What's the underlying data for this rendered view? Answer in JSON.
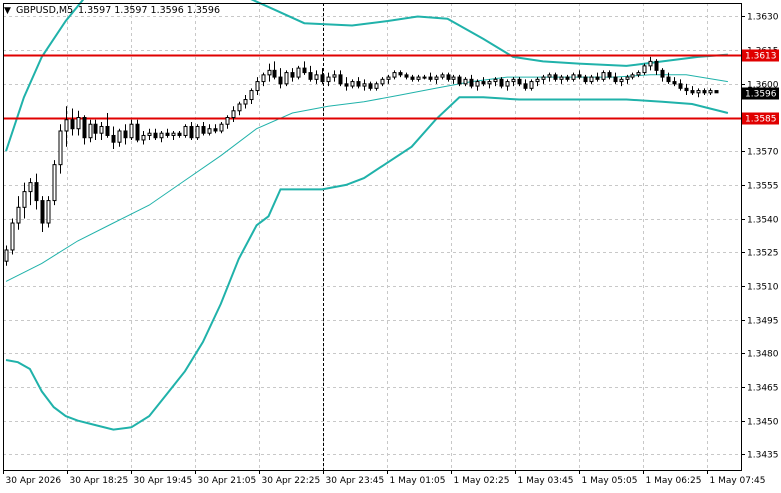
{
  "header": {
    "symbol_timeframe": "GBPUSD,M5",
    "ohlc": "1.3597 1.3597 1.3596 1.3596"
  },
  "colors": {
    "background": "#ffffff",
    "grid": "#c8c8c8",
    "candle": "#000000",
    "bollinger": "#20b2aa",
    "level_line": "#e00000",
    "level_label_bg": "#e00000",
    "price_label_bg": "#000000"
  },
  "chart_data": {
    "type": "candlestick",
    "grid": true,
    "y_axis": {
      "position": "right",
      "range": [
        1.3428,
        1.3636
      ],
      "ticks": [
        "1.3630",
        "1.3615",
        "1.3600",
        "1.3585",
        "1.3570",
        "1.3555",
        "1.3540",
        "1.3525",
        "1.3510",
        "1.3495",
        "1.3480",
        "1.3465",
        "1.3450",
        "1.3435"
      ]
    },
    "x_axis": {
      "ticks": [
        "30 Apr 2026",
        "30 Apr 18:25",
        "30 Apr 19:45",
        "30 Apr 21:05",
        "30 Apr 22:25",
        "30 Apr 23:45",
        "1 May 01:05",
        "1 May 02:25",
        "1 May 03:45",
        "1 May 05:05",
        "1 May 06:25",
        "1 May 07:45"
      ]
    },
    "horizontal_levels": [
      {
        "price": 1.3613,
        "label": "1.3613"
      },
      {
        "price": 1.3585,
        "label": "1.3585"
      }
    ],
    "current_price": {
      "price": 1.3596,
      "label": "1.3596"
    },
    "period_separator_after": "30 Apr 23:45",
    "candles": [
      {
        "o": 1.3521,
        "h": 1.3528,
        "l": 1.3519,
        "c": 1.3526
      },
      {
        "o": 1.3526,
        "h": 1.354,
        "l": 1.3524,
        "c": 1.3538
      },
      {
        "o": 1.3538,
        "h": 1.355,
        "l": 1.3535,
        "c": 1.3545
      },
      {
        "o": 1.3545,
        "h": 1.3556,
        "l": 1.354,
        "c": 1.3552
      },
      {
        "o": 1.3552,
        "h": 1.3558,
        "l": 1.3546,
        "c": 1.3556
      },
      {
        "o": 1.3556,
        "h": 1.356,
        "l": 1.3544,
        "c": 1.3548
      },
      {
        "o": 1.3548,
        "h": 1.355,
        "l": 1.3534,
        "c": 1.3538
      },
      {
        "o": 1.3538,
        "h": 1.355,
        "l": 1.3536,
        "c": 1.3548
      },
      {
        "o": 1.3548,
        "h": 1.3566,
        "l": 1.3546,
        "c": 1.3564
      },
      {
        "o": 1.3564,
        "h": 1.3582,
        "l": 1.356,
        "c": 1.3579
      },
      {
        "o": 1.3579,
        "h": 1.359,
        "l": 1.3572,
        "c": 1.3584
      },
      {
        "o": 1.3584,
        "h": 1.3589,
        "l": 1.3577,
        "c": 1.358
      },
      {
        "o": 1.358,
        "h": 1.3588,
        "l": 1.3577,
        "c": 1.3585
      },
      {
        "o": 1.3585,
        "h": 1.3586,
        "l": 1.3573,
        "c": 1.3576
      },
      {
        "o": 1.3576,
        "h": 1.3584,
        "l": 1.3574,
        "c": 1.3582
      },
      {
        "o": 1.3582,
        "h": 1.3584,
        "l": 1.3575,
        "c": 1.3578
      },
      {
        "o": 1.3578,
        "h": 1.3583,
        "l": 1.3575,
        "c": 1.3581
      },
      {
        "o": 1.3581,
        "h": 1.3587,
        "l": 1.3576,
        "c": 1.3577
      },
      {
        "o": 1.3577,
        "h": 1.3581,
        "l": 1.3571,
        "c": 1.3574
      },
      {
        "o": 1.3574,
        "h": 1.358,
        "l": 1.3572,
        "c": 1.3579
      },
      {
        "o": 1.3579,
        "h": 1.3582,
        "l": 1.3573,
        "c": 1.3576
      },
      {
        "o": 1.3576,
        "h": 1.3584,
        "l": 1.3575,
        "c": 1.3582
      },
      {
        "o": 1.3582,
        "h": 1.3584,
        "l": 1.3574,
        "c": 1.3575
      },
      {
        "o": 1.3575,
        "h": 1.3579,
        "l": 1.3573,
        "c": 1.3577
      },
      {
        "o": 1.3577,
        "h": 1.358,
        "l": 1.3575,
        "c": 1.3578
      },
      {
        "o": 1.3578,
        "h": 1.358,
        "l": 1.3575,
        "c": 1.3576
      },
      {
        "o": 1.3576,
        "h": 1.3579,
        "l": 1.3574,
        "c": 1.3578
      },
      {
        "o": 1.3578,
        "h": 1.358,
        "l": 1.3576,
        "c": 1.3577
      },
      {
        "o": 1.3577,
        "h": 1.3579,
        "l": 1.3575,
        "c": 1.3578
      },
      {
        "o": 1.3578,
        "h": 1.3579,
        "l": 1.3576,
        "c": 1.3577
      },
      {
        "o": 1.3577,
        "h": 1.3582,
        "l": 1.3576,
        "c": 1.3581
      },
      {
        "o": 1.3581,
        "h": 1.3583,
        "l": 1.3575,
        "c": 1.3576
      },
      {
        "o": 1.3576,
        "h": 1.3582,
        "l": 1.3575,
        "c": 1.3581
      },
      {
        "o": 1.3581,
        "h": 1.3583,
        "l": 1.3577,
        "c": 1.3578
      },
      {
        "o": 1.3578,
        "h": 1.3582,
        "l": 1.3577,
        "c": 1.358
      },
      {
        "o": 1.358,
        "h": 1.3582,
        "l": 1.3578,
        "c": 1.3579
      },
      {
        "o": 1.3579,
        "h": 1.3583,
        "l": 1.3578,
        "c": 1.3582
      },
      {
        "o": 1.3582,
        "h": 1.3586,
        "l": 1.358,
        "c": 1.3585
      },
      {
        "o": 1.3585,
        "h": 1.359,
        "l": 1.3583,
        "c": 1.3588
      },
      {
        "o": 1.3588,
        "h": 1.3592,
        "l": 1.3586,
        "c": 1.3591
      },
      {
        "o": 1.3591,
        "h": 1.3595,
        "l": 1.3589,
        "c": 1.3593
      },
      {
        "o": 1.3593,
        "h": 1.3598,
        "l": 1.3591,
        "c": 1.3597
      },
      {
        "o": 1.3597,
        "h": 1.3603,
        "l": 1.3595,
        "c": 1.3601
      },
      {
        "o": 1.3601,
        "h": 1.3605,
        "l": 1.3599,
        "c": 1.3604
      },
      {
        "o": 1.3604,
        "h": 1.3609,
        "l": 1.3601,
        "c": 1.3606
      },
      {
        "o": 1.3606,
        "h": 1.361,
        "l": 1.3602,
        "c": 1.3603
      },
      {
        "o": 1.3603,
        "h": 1.3607,
        "l": 1.3598,
        "c": 1.36
      },
      {
        "o": 1.36,
        "h": 1.3606,
        "l": 1.3599,
        "c": 1.3605
      },
      {
        "o": 1.3605,
        "h": 1.3607,
        "l": 1.3601,
        "c": 1.3603
      },
      {
        "o": 1.3603,
        "h": 1.3608,
        "l": 1.3602,
        "c": 1.3607
      },
      {
        "o": 1.3607,
        "h": 1.361,
        "l": 1.3604,
        "c": 1.3605
      },
      {
        "o": 1.3605,
        "h": 1.3608,
        "l": 1.3601,
        "c": 1.3602
      },
      {
        "o": 1.3602,
        "h": 1.3606,
        "l": 1.36,
        "c": 1.3604
      },
      {
        "o": 1.3604,
        "h": 1.3607,
        "l": 1.36,
        "c": 1.3601
      },
      {
        "o": 1.3601,
        "h": 1.3605,
        "l": 1.3599,
        "c": 1.3603
      },
      {
        "o": 1.3603,
        "h": 1.3606,
        "l": 1.3601,
        "c": 1.3604
      },
      {
        "o": 1.3604,
        "h": 1.3606,
        "l": 1.3599,
        "c": 1.36
      },
      {
        "o": 1.36,
        "h": 1.3603,
        "l": 1.3597,
        "c": 1.3599
      },
      {
        "o": 1.3599,
        "h": 1.3602,
        "l": 1.3598,
        "c": 1.3601
      },
      {
        "o": 1.3601,
        "h": 1.3603,
        "l": 1.3598,
        "c": 1.3599
      },
      {
        "o": 1.3599,
        "h": 1.3602,
        "l": 1.3597,
        "c": 1.36
      },
      {
        "o": 1.36,
        "h": 1.3601,
        "l": 1.3597,
        "c": 1.3598
      },
      {
        "o": 1.3598,
        "h": 1.3601,
        "l": 1.3597,
        "c": 1.36
      },
      {
        "o": 1.36,
        "h": 1.3603,
        "l": 1.3599,
        "c": 1.3602
      },
      {
        "o": 1.3602,
        "h": 1.3604,
        "l": 1.36,
        "c": 1.3603
      },
      {
        "o": 1.3603,
        "h": 1.3606,
        "l": 1.3602,
        "c": 1.3605
      },
      {
        "o": 1.3605,
        "h": 1.3606,
        "l": 1.3603,
        "c": 1.3604
      },
      {
        "o": 1.3604,
        "h": 1.3605,
        "l": 1.3602,
        "c": 1.3603
      },
      {
        "o": 1.3603,
        "h": 1.3604,
        "l": 1.3601,
        "c": 1.3602
      },
      {
        "o": 1.3602,
        "h": 1.3604,
        "l": 1.3601,
        "c": 1.3603
      },
      {
        "o": 1.3603,
        "h": 1.3604,
        "l": 1.3602,
        "c": 1.3603
      },
      {
        "o": 1.3603,
        "h": 1.3605,
        "l": 1.3601,
        "c": 1.3602
      },
      {
        "o": 1.3602,
        "h": 1.3604,
        "l": 1.36,
        "c": 1.3603
      },
      {
        "o": 1.3603,
        "h": 1.3605,
        "l": 1.3602,
        "c": 1.3604
      },
      {
        "o": 1.3604,
        "h": 1.3605,
        "l": 1.3601,
        "c": 1.3602
      },
      {
        "o": 1.3602,
        "h": 1.3604,
        "l": 1.36,
        "c": 1.3603
      },
      {
        "o": 1.3603,
        "h": 1.3604,
        "l": 1.3599,
        "c": 1.36
      },
      {
        "o": 1.36,
        "h": 1.3603,
        "l": 1.3599,
        "c": 1.3602
      },
      {
        "o": 1.3602,
        "h": 1.3604,
        "l": 1.3598,
        "c": 1.3599
      },
      {
        "o": 1.3599,
        "h": 1.3602,
        "l": 1.3597,
        "c": 1.3601
      },
      {
        "o": 1.3601,
        "h": 1.3603,
        "l": 1.3599,
        "c": 1.36
      },
      {
        "o": 1.36,
        "h": 1.3602,
        "l": 1.3598,
        "c": 1.3601
      },
      {
        "o": 1.3601,
        "h": 1.3603,
        "l": 1.3599,
        "c": 1.3602
      },
      {
        "o": 1.3602,
        "h": 1.3603,
        "l": 1.3598,
        "c": 1.3599
      },
      {
        "o": 1.3599,
        "h": 1.3602,
        "l": 1.3597,
        "c": 1.3601
      },
      {
        "o": 1.3601,
        "h": 1.3603,
        "l": 1.3599,
        "c": 1.3602
      },
      {
        "o": 1.3602,
        "h": 1.3603,
        "l": 1.3599,
        "c": 1.36
      },
      {
        "o": 1.36,
        "h": 1.3602,
        "l": 1.3597,
        "c": 1.3598
      },
      {
        "o": 1.3598,
        "h": 1.3602,
        "l": 1.3597,
        "c": 1.3601
      },
      {
        "o": 1.3601,
        "h": 1.3603,
        "l": 1.3599,
        "c": 1.3602
      },
      {
        "o": 1.3602,
        "h": 1.3604,
        "l": 1.36,
        "c": 1.3603
      },
      {
        "o": 1.3603,
        "h": 1.3605,
        "l": 1.3601,
        "c": 1.3604
      },
      {
        "o": 1.3604,
        "h": 1.3605,
        "l": 1.3601,
        "c": 1.3602
      },
      {
        "o": 1.3602,
        "h": 1.3604,
        "l": 1.36,
        "c": 1.3603
      },
      {
        "o": 1.3603,
        "h": 1.3604,
        "l": 1.3601,
        "c": 1.3602
      },
      {
        "o": 1.3602,
        "h": 1.3605,
        "l": 1.3601,
        "c": 1.3604
      },
      {
        "o": 1.3604,
        "h": 1.3606,
        "l": 1.3602,
        "c": 1.3603
      },
      {
        "o": 1.3603,
        "h": 1.3604,
        "l": 1.36,
        "c": 1.3601
      },
      {
        "o": 1.3601,
        "h": 1.3604,
        "l": 1.36,
        "c": 1.3603
      },
      {
        "o": 1.3603,
        "h": 1.3605,
        "l": 1.3601,
        "c": 1.3602
      },
      {
        "o": 1.3602,
        "h": 1.3606,
        "l": 1.3601,
        "c": 1.3605
      },
      {
        "o": 1.3605,
        "h": 1.3606,
        "l": 1.3602,
        "c": 1.3603
      },
      {
        "o": 1.3603,
        "h": 1.3605,
        "l": 1.36,
        "c": 1.3601
      },
      {
        "o": 1.3601,
        "h": 1.3603,
        "l": 1.3599,
        "c": 1.3602
      },
      {
        "o": 1.3602,
        "h": 1.3604,
        "l": 1.36,
        "c": 1.3603
      },
      {
        "o": 1.3603,
        "h": 1.3605,
        "l": 1.3602,
        "c": 1.3604
      },
      {
        "o": 1.3604,
        "h": 1.3606,
        "l": 1.3603,
        "c": 1.3605
      },
      {
        "o": 1.3605,
        "h": 1.3609,
        "l": 1.3604,
        "c": 1.3608
      },
      {
        "o": 1.3608,
        "h": 1.3612,
        "l": 1.3606,
        "c": 1.361
      },
      {
        "o": 1.361,
        "h": 1.3611,
        "l": 1.3604,
        "c": 1.3606
      },
      {
        "o": 1.3606,
        "h": 1.3607,
        "l": 1.3601,
        "c": 1.3603
      },
      {
        "o": 1.3603,
        "h": 1.3605,
        "l": 1.36,
        "c": 1.3601
      },
      {
        "o": 1.3601,
        "h": 1.3603,
        "l": 1.3599,
        "c": 1.36
      },
      {
        "o": 1.36,
        "h": 1.3602,
        "l": 1.3597,
        "c": 1.3598
      },
      {
        "o": 1.3598,
        "h": 1.36,
        "l": 1.3595,
        "c": 1.3597
      },
      {
        "o": 1.3597,
        "h": 1.3599,
        "l": 1.3595,
        "c": 1.3596
      },
      {
        "o": 1.3596,
        "h": 1.3598,
        "l": 1.3594,
        "c": 1.3597
      },
      {
        "o": 1.3597,
        "h": 1.3598,
        "l": 1.3595,
        "c": 1.3596
      },
      {
        "o": 1.3596,
        "h": 1.3598,
        "l": 1.3595,
        "c": 1.3597
      },
      {
        "o": 1.3597,
        "h": 1.3597,
        "l": 1.3596,
        "c": 1.3596
      }
    ],
    "bollinger": {
      "upper": [
        [
          0,
          1.357
        ],
        [
          3,
          1.3594
        ],
        [
          6,
          1.3612
        ],
        [
          10,
          1.3628
        ],
        [
          14,
          1.3641
        ],
        [
          17,
          1.365
        ],
        [
          20,
          1.3648
        ],
        [
          25,
          1.3642
        ],
        [
          30,
          1.364
        ],
        [
          40,
          1.3639
        ],
        [
          45,
          1.3633
        ],
        [
          50,
          1.3627
        ],
        [
          58,
          1.3626
        ],
        [
          64,
          1.3628
        ],
        [
          69,
          1.363
        ],
        [
          74,
          1.3629
        ],
        [
          80,
          1.362
        ],
        [
          85,
          1.3612
        ],
        [
          90,
          1.361
        ],
        [
          96,
          1.3609
        ],
        [
          104,
          1.3608
        ],
        [
          110,
          1.361
        ],
        [
          116,
          1.3612
        ],
        [
          121,
          1.3613
        ]
      ],
      "middle": [
        [
          0,
          1.3512
        ],
        [
          6,
          1.352
        ],
        [
          12,
          1.353
        ],
        [
          18,
          1.3538
        ],
        [
          24,
          1.3546
        ],
        [
          30,
          1.3557
        ],
        [
          36,
          1.3568
        ],
        [
          42,
          1.358
        ],
        [
          48,
          1.3587
        ],
        [
          54,
          1.359
        ],
        [
          60,
          1.3592
        ],
        [
          66,
          1.3595
        ],
        [
          72,
          1.3598
        ],
        [
          78,
          1.3601
        ],
        [
          84,
          1.3603
        ],
        [
          90,
          1.3603
        ],
        [
          96,
          1.3603
        ],
        [
          102,
          1.3603
        ],
        [
          108,
          1.3604
        ],
        [
          114,
          1.3604
        ],
        [
          121,
          1.3601
        ]
      ],
      "lower": [
        [
          0,
          1.3477
        ],
        [
          2,
          1.3476
        ],
        [
          4,
          1.3473
        ],
        [
          6,
          1.3463
        ],
        [
          8,
          1.3456
        ],
        [
          10,
          1.3452
        ],
        [
          12,
          1.345
        ],
        [
          15,
          1.3448
        ],
        [
          18,
          1.3446
        ],
        [
          21,
          1.3447
        ],
        [
          24,
          1.3452
        ],
        [
          27,
          1.3462
        ],
        [
          30,
          1.3472
        ],
        [
          33,
          1.3485
        ],
        [
          36,
          1.3502
        ],
        [
          39,
          1.3522
        ],
        [
          42,
          1.3537
        ],
        [
          44,
          1.3541
        ],
        [
          46,
          1.3553
        ],
        [
          50,
          1.3553
        ],
        [
          53,
          1.3553
        ],
        [
          57,
          1.3555
        ],
        [
          60,
          1.3558
        ],
        [
          64,
          1.3565
        ],
        [
          68,
          1.3572
        ],
        [
          72,
          1.3584
        ],
        [
          76,
          1.3594
        ],
        [
          80,
          1.3594
        ],
        [
          86,
          1.3593
        ],
        [
          92,
          1.3593
        ],
        [
          98,
          1.3593
        ],
        [
          104,
          1.3593
        ],
        [
          110,
          1.3592
        ],
        [
          115,
          1.3591
        ],
        [
          121,
          1.3587
        ]
      ]
    }
  }
}
